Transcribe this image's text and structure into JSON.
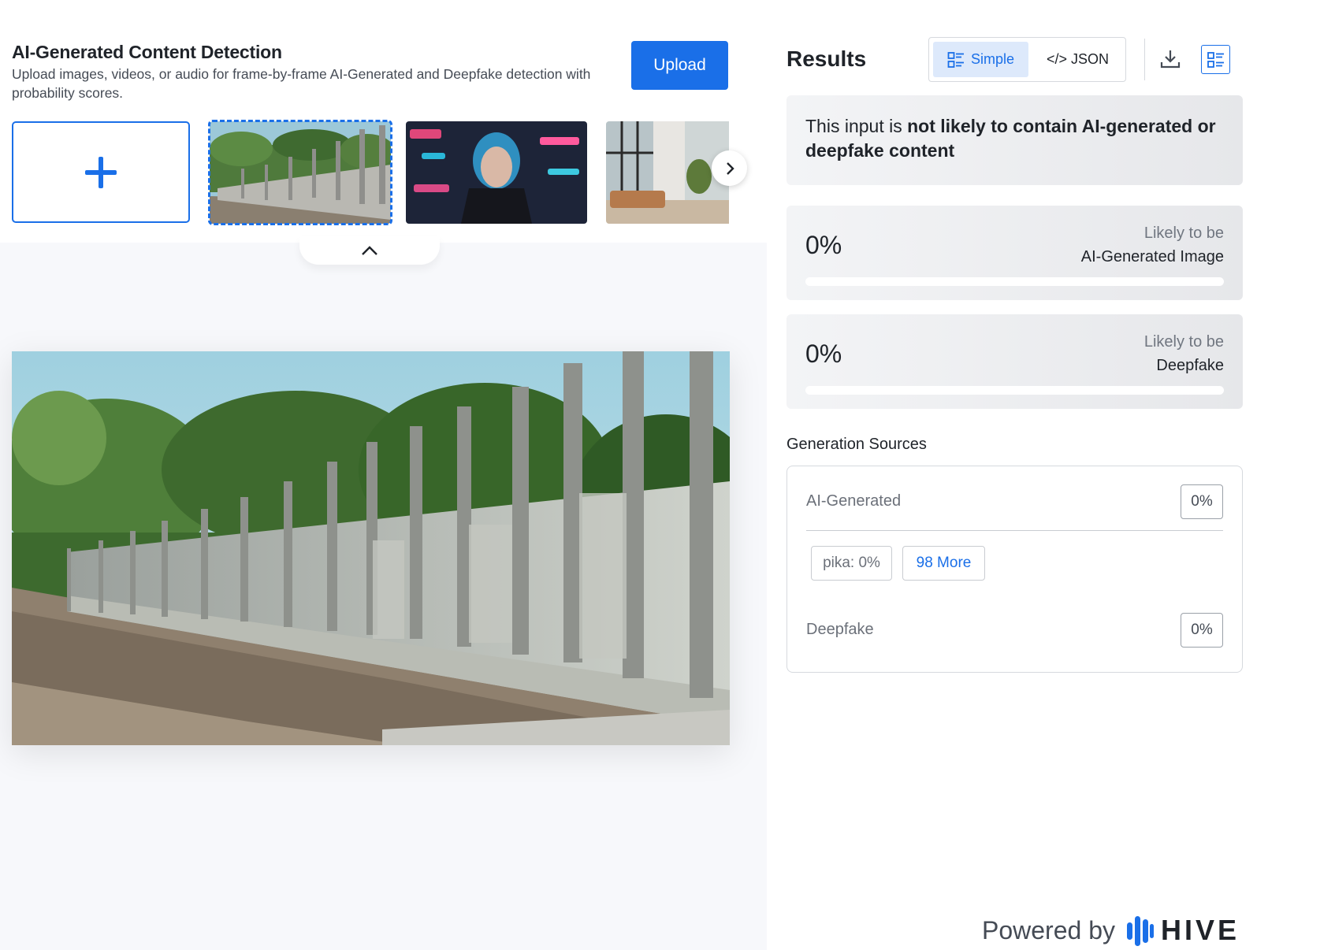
{
  "header": {
    "title": "AI-Generated Content Detection",
    "subtitle": "Upload images, videos, or audio for frame-by-frame AI-Generated and Deepfake detection with probability scores.",
    "upload_label": "Upload"
  },
  "thumbnails": [
    {
      "subject": "concrete fence posts",
      "selected": true
    },
    {
      "subject": "cyberpunk portrait"
    },
    {
      "subject": "modern living room"
    }
  ],
  "icons": {
    "add": "plus-icon",
    "next": "chevron-right-icon",
    "collapse": "chevron-up-icon",
    "simple": "list-icon",
    "download": "download-icon",
    "layout": "layout-icon"
  },
  "results": {
    "title": "Results",
    "view_simple": "Simple",
    "view_json": "</> JSON",
    "verdict_prefix": "This input is ",
    "verdict_bold": "not likely to contain AI-generated or deepfake content",
    "scores": [
      {
        "value": "0%",
        "label_top": "Likely to be",
        "label_bottom": "AI-Generated Image",
        "fraction": 0
      },
      {
        "value": "0%",
        "label_top": "Likely to be",
        "label_bottom": "Deepfake",
        "fraction": 0
      }
    ]
  },
  "generation": {
    "title": "Generation Sources",
    "ai_label": "AI-Generated",
    "ai_value": "0%",
    "chip_source": "pika: 0%",
    "chip_more": "98 More",
    "deepfake_label": "Deepfake",
    "deepfake_value": "0%"
  },
  "footer": {
    "powered_by": "Powered by",
    "brand": "HIVE"
  },
  "colors": {
    "accent": "#1a6fe8",
    "text": "#1f2329",
    "muted": "#6b7079"
  }
}
